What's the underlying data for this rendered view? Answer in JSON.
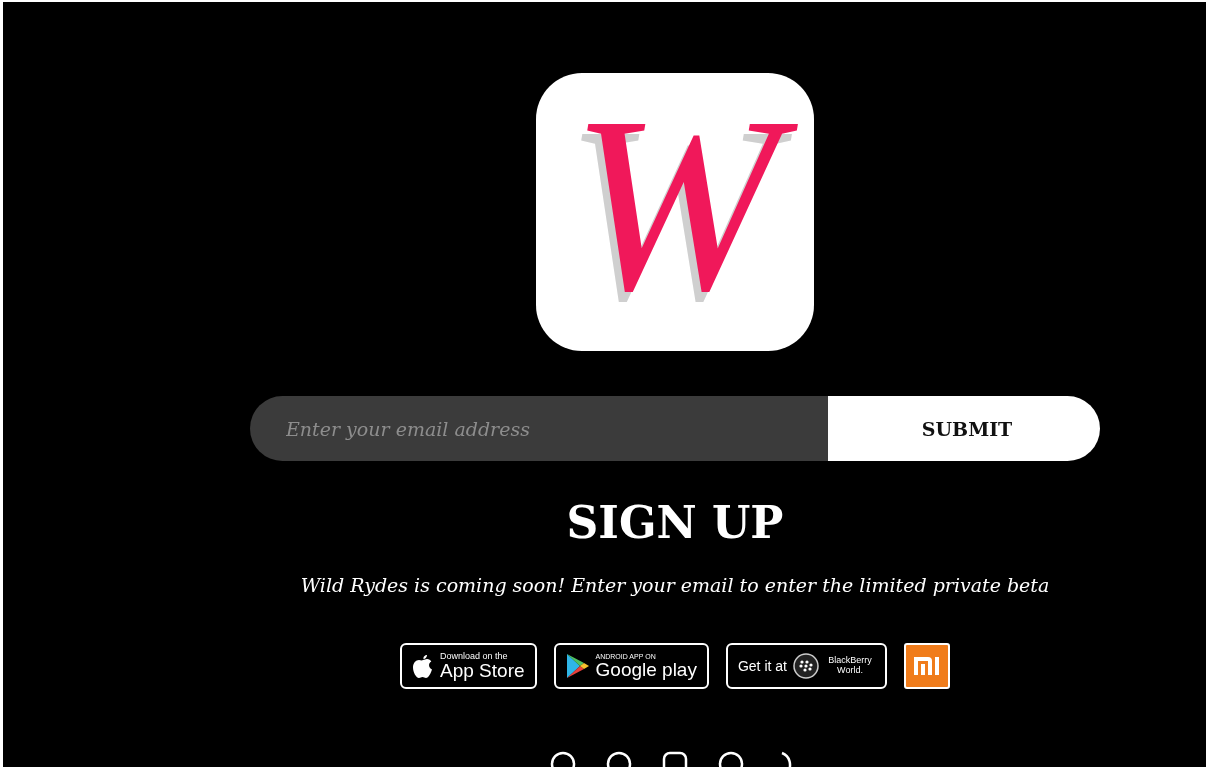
{
  "logo": {
    "letter": "W"
  },
  "signup_form": {
    "email_field": {
      "placeholder": "Enter your email address"
    },
    "submit_button": "SUBMIT"
  },
  "heading": "SIGN UP",
  "tagline": "Wild Rydes is coming soon! Enter your email to enter the limited private beta",
  "store_badges": [
    {
      "kind": "apple",
      "small_text": "Download on the",
      "large_text": "App Store"
    },
    {
      "kind": "google",
      "small_text": "ANDROID APP ON",
      "large_text": "Google play"
    },
    {
      "kind": "blackberry",
      "small_text": "Get it at",
      "large_text": "BlackBerry World."
    },
    {
      "kind": "mi"
    }
  ]
}
